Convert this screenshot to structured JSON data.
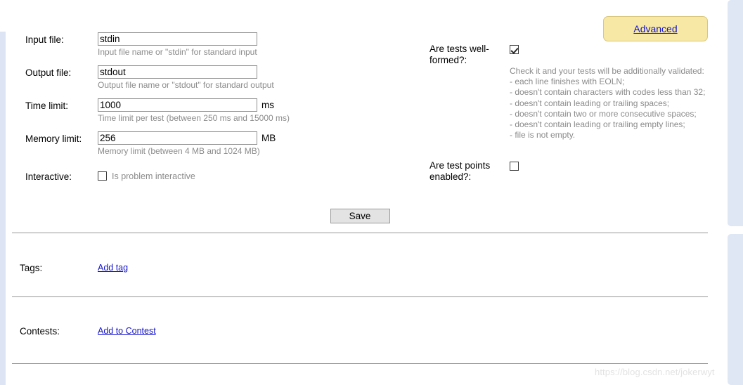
{
  "form": {
    "input_file": {
      "label": "Input file:",
      "value": "stdin",
      "hint": "Input file name or \"stdin\" for standard input"
    },
    "output_file": {
      "label": "Output file:",
      "value": "stdout",
      "hint": "Output file name or \"stdout\" for standard output"
    },
    "time_limit": {
      "label": "Time limit:",
      "value": "1000",
      "unit": "ms",
      "hint": "Time limit per test (between 250 ms and 15000 ms)"
    },
    "memory_limit": {
      "label": "Memory limit:",
      "value": "256",
      "unit": "MB",
      "hint": "Memory limit (between 4 MB and 1024 MB)"
    },
    "interactive": {
      "label": "Interactive:",
      "checkbox_label": "Is problem interactive",
      "checked": false
    }
  },
  "right": {
    "advanced_label": "Advanced",
    "well_formed": {
      "label": "Are tests well-formed?:",
      "checked": true,
      "hint_intro": "Check it and your tests will be additionally validated:",
      "hint_lines": [
        "- each line finishes with EOLN;",
        "- doesn't contain characters with codes less than 32;",
        "- doesn't contain leading or trailing spaces;",
        "- doesn't contain two or more consecutive spaces;",
        "- doesn't contain leading or trailing empty lines;",
        "- file is not empty."
      ]
    },
    "test_points": {
      "label": "Are test points enabled?:",
      "checked": false
    }
  },
  "actions": {
    "save_label": "Save"
  },
  "sections": {
    "tags": {
      "label": "Tags:",
      "link": "Add tag"
    },
    "contests": {
      "label": "Contests:",
      "link": "Add to Contest"
    }
  },
  "watermark": "https://blog.csdn.net/jokerwyt",
  "colors": {
    "link": "#1414cc",
    "advanced_bg": "#f7e8a6",
    "hint_text": "#8b8b8b",
    "rail": "#dfe7f5"
  }
}
